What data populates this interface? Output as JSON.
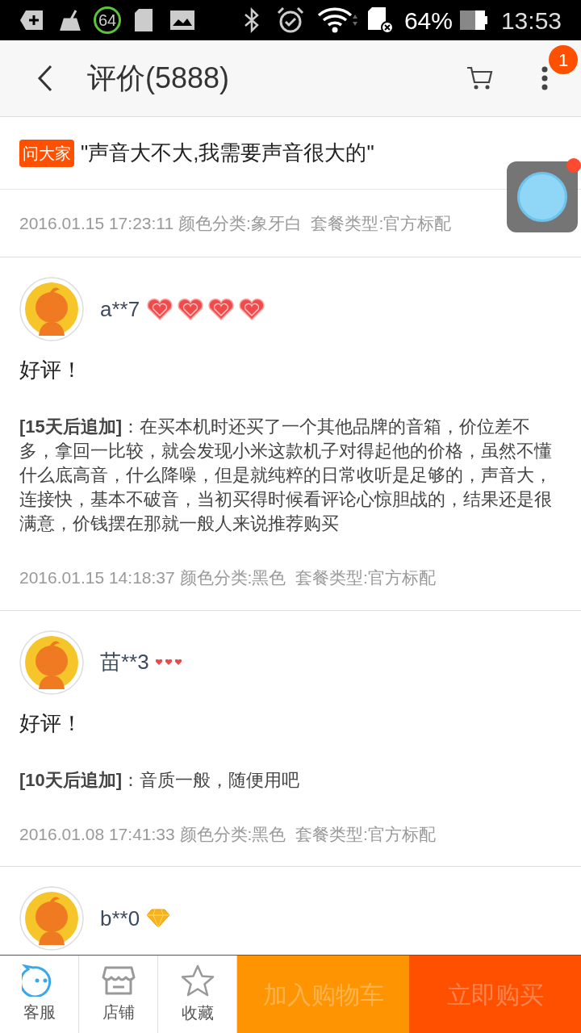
{
  "status_bar": {
    "ring_text": "64",
    "battery": "64%",
    "time": "13:53"
  },
  "header": {
    "title": "评价(5888)",
    "menu_badge": "1"
  },
  "question": {
    "tag": "问大家",
    "text": "\"声音大不大,我需要声音很大的\"",
    "meta": "2016.01.15 17:23:11 颜色分类:象牙白  套餐类型:官方标配"
  },
  "reviews": [
    {
      "user": "a**7",
      "badges": [
        {
          "kind": "heart"
        },
        {
          "kind": "heart"
        },
        {
          "kind": "heart"
        },
        {
          "kind": "heart"
        }
      ],
      "text": "好评！",
      "addition": "**[15天后追加]**：在买本机时还买了一个其他品牌的音箱，价位差不多，拿回一比较，就会发现小米这款机子对得起他的价格，虽然不懂什么底高音，什么降噪，但是就纯粹的日常收听是足够的，声音大，连接快，基本不破音，当初买得时候看评论心惊胆战的，结果还是很满意，价钱摆在那就一般人来说推荐购买",
      "meta": "2016.01.15 14:18:37 颜色分类:黑色  套餐类型:官方标配"
    },
    {
      "user": "苗**3",
      "badges": [
        {
          "kind": "small-heart"
        },
        {
          "kind": "small-heart"
        },
        {
          "kind": "small-heart"
        }
      ],
      "text": "好评！",
      "addition": "**[10天后追加]**：音质一般，随便用吧",
      "meta": "2016.01.08 17:41:33 颜色分类:黑色  套餐类型:官方标配"
    },
    {
      "user": "b**0",
      "badges": [
        {
          "kind": "diamond"
        }
      ]
    }
  ],
  "bottom_bar": {
    "items": [
      {
        "kind": "service",
        "label": "客服"
      },
      {
        "kind": "shop",
        "label": "店铺"
      },
      {
        "kind": "favorite",
        "label": "收藏"
      }
    ],
    "actions": [
      {
        "kind": "cart",
        "label": "加入购物车",
        "disabled": true
      },
      {
        "kind": "buy",
        "label": "立即购买",
        "disabled": true
      }
    ]
  }
}
